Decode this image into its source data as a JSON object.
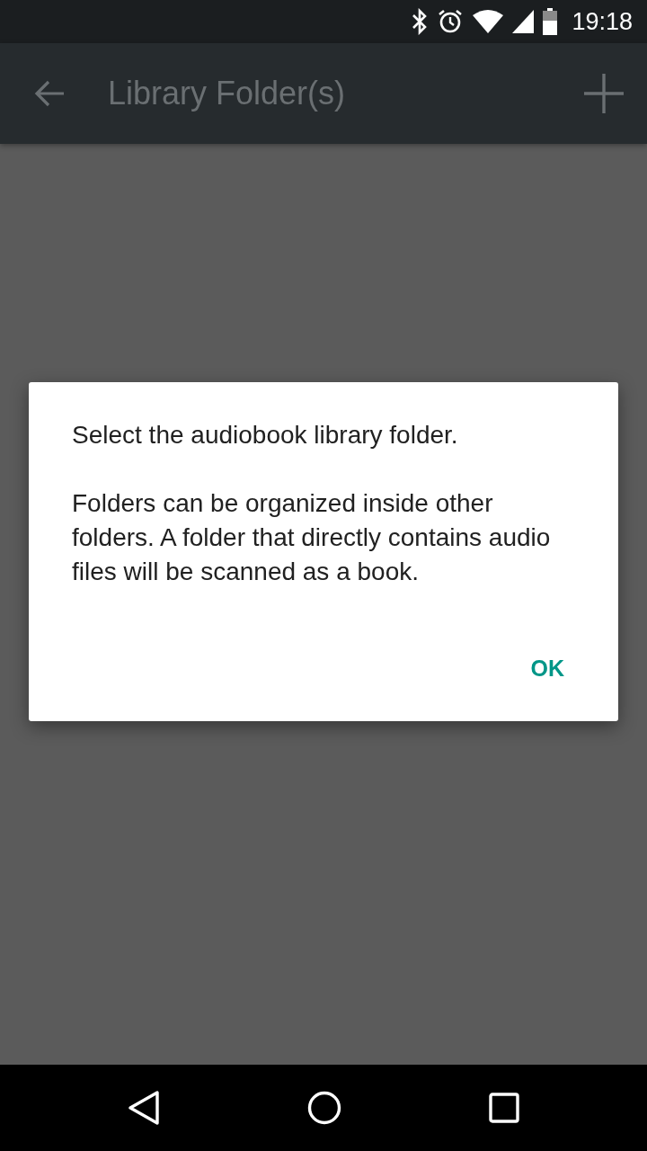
{
  "status_bar": {
    "time": "19:18"
  },
  "toolbar": {
    "title": "Library Folder(s)"
  },
  "dialog": {
    "paragraphs": [
      "Select the audiobook library folder.",
      "Folders can be organized inside other folders. A folder that directly contains audio files will be scanned as a book."
    ],
    "buttons": [
      "OK"
    ]
  }
}
